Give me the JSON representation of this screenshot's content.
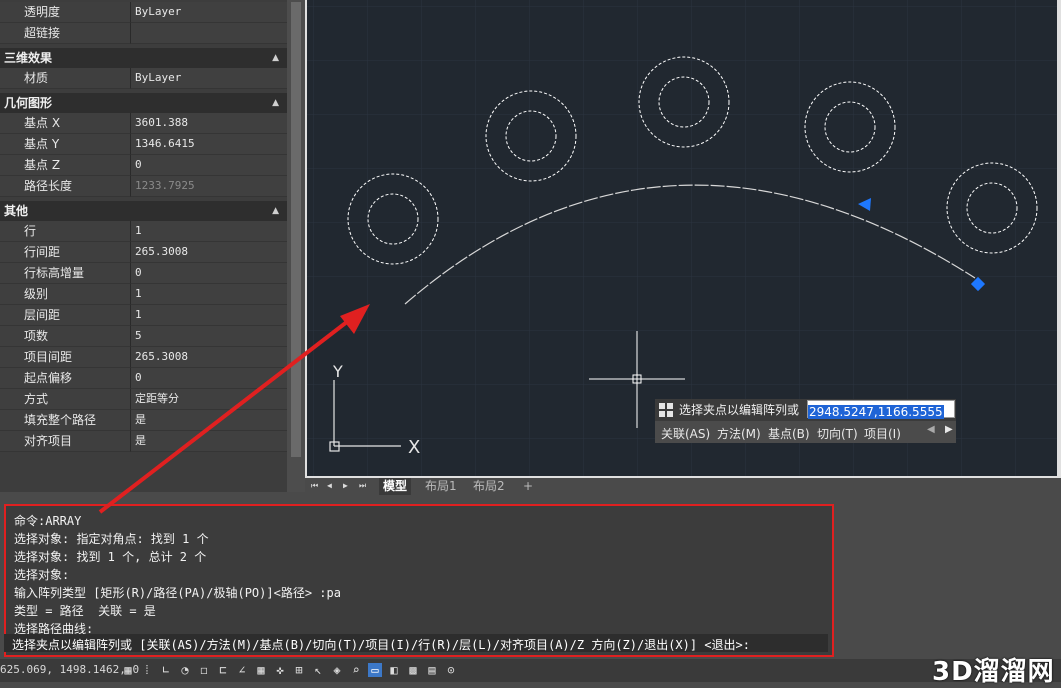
{
  "properties": {
    "rows_top": [
      {
        "label": "透明度",
        "value": "ByLayer"
      },
      {
        "label": "超链接",
        "value": ""
      }
    ],
    "section_3d": {
      "title": "三维效果",
      "rows": [
        {
          "label": "材质",
          "value": "ByLayer"
        }
      ]
    },
    "section_geometry": {
      "title": "几何图形",
      "rows": [
        {
          "label": "基点 X",
          "value": "3601.388"
        },
        {
          "label": "基点 Y",
          "value": "1346.6415"
        },
        {
          "label": "基点 Z",
          "value": "0"
        },
        {
          "label": "路径长度",
          "value": "1233.7925"
        }
      ]
    },
    "section_other": {
      "title": "其他",
      "rows": [
        {
          "label": "行",
          "value": "1"
        },
        {
          "label": "行间距",
          "value": "265.3008"
        },
        {
          "label": "行标高增量",
          "value": "0"
        },
        {
          "label": "级别",
          "value": "1"
        },
        {
          "label": "层间距",
          "value": "1"
        },
        {
          "label": "项数",
          "value": "5"
        },
        {
          "label": "项目间距",
          "value": "265.3008"
        },
        {
          "label": "起点偏移",
          "value": "0"
        },
        {
          "label": "方式",
          "value": "定距等分"
        },
        {
          "label": "填充整个路径",
          "value": "是"
        },
        {
          "label": "对齐项目",
          "value": "是"
        }
      ]
    },
    "collapse_icon": "▲"
  },
  "layout_tabs": {
    "nav": [
      "⏮",
      "◀",
      "▶",
      "⏭"
    ],
    "tabs": [
      "模型",
      "布局1",
      "布局2",
      "+"
    ]
  },
  "dynamic_input": {
    "prompt": "选择夹点以编辑阵列或",
    "value": "2948.5247,1166.5555",
    "options": [
      "关联(AS)",
      "方法(M)",
      "基点(B)",
      "切向(T)",
      "项目(I)"
    ],
    "nav_left": "◀",
    "nav_right": "▶"
  },
  "command_history": [
    "命令:ARRAY",
    "选择对象: 指定对角点: 找到 1 个",
    "选择对象: 找到 1 个, 总计 2 个",
    "选择对象:",
    "输入阵列类型 [矩形(R)/路径(PA)/极轴(PO)]<路径> :pa",
    "类型 = 路径  关联 = 是",
    "选择路径曲线:"
  ],
  "command_prompt": "选择夹点以编辑阵列或 [关联(AS)/方法(M)/基点(B)/切向(T)/项目(I)/行(R)/层(L)/对齐项目(A)/Z 方向(Z)/退出(X)] <退出>:",
  "status_bar": {
    "coordinates": "625.069, 1498.1462, 0",
    "icons": [
      "grid-icon",
      "snap-icon",
      "ortho-icon",
      "polar-icon",
      "osnap-icon",
      "otrack-icon",
      "ducs-icon",
      "dyn-icon",
      "lineweight-icon",
      "transparency-icon",
      "selection-icon",
      "gizmo-icon",
      "annotation-icon",
      "workspace-icon",
      "isolate-icon",
      "hardware-icon",
      "clean-icon",
      "customize-icon"
    ]
  },
  "ucs": {
    "y_label": "Y",
    "x_label": "X"
  },
  "watermark": "3D溜溜网",
  "colors": {
    "canvas": "#212830",
    "grip": "#1e78ff",
    "highlight": "#e02020"
  }
}
